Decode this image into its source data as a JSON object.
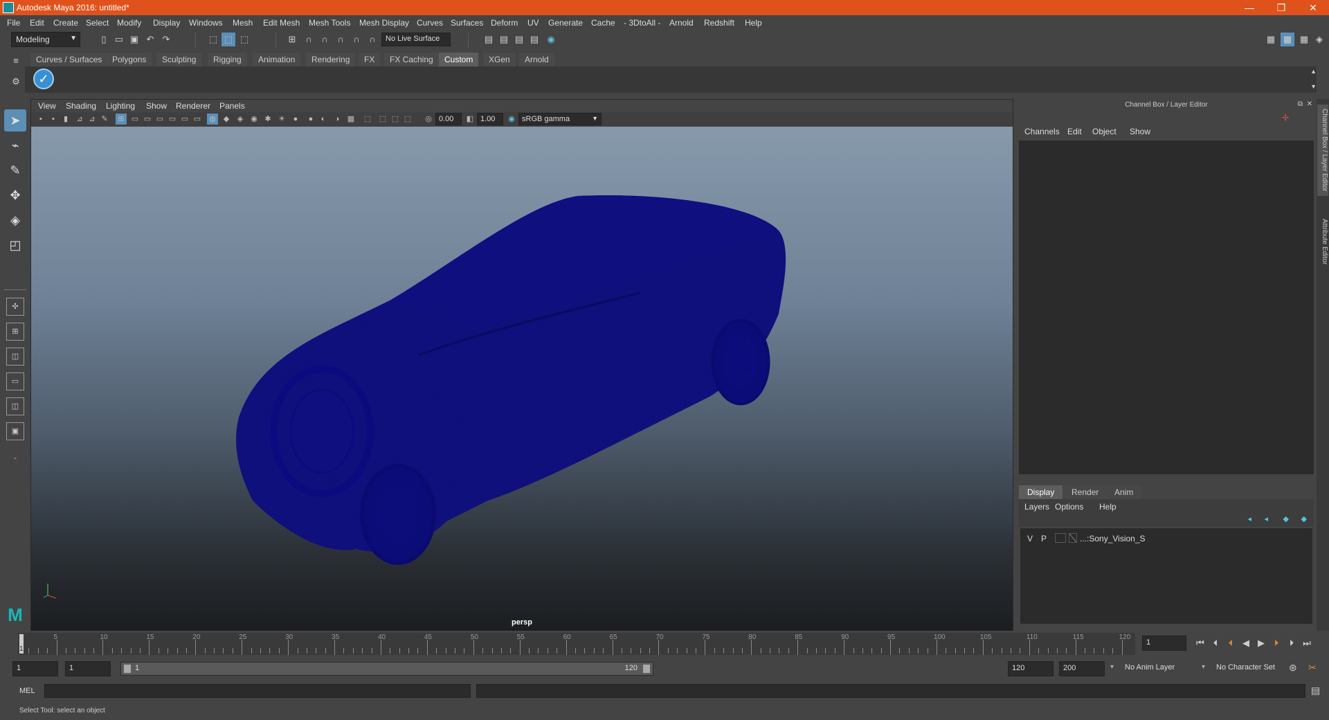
{
  "window": {
    "title": "Autodesk Maya 2016: untitled*",
    "minimize": "—",
    "maximize": "❐",
    "close": "✕"
  },
  "menubar": [
    "File",
    "Edit",
    "Create",
    "Select",
    "Modify",
    "Display",
    "Windows",
    "Mesh",
    "Edit Mesh",
    "Mesh Tools",
    "Mesh Display",
    "Curves",
    "Surfaces",
    "Deform",
    "UV",
    "Generate",
    "Cache",
    "- 3DtoAll -",
    "Arnold",
    "Redshift",
    "Help"
  ],
  "statusline": {
    "mode": "Modeling",
    "live_surface": "No Live Surface"
  },
  "shelf": {
    "tabs": [
      "Curves / Surfaces",
      "Polygons",
      "Sculpting",
      "Rigging",
      "Animation",
      "Rendering",
      "FX",
      "FX Caching",
      "Custom",
      "XGen",
      "Arnold"
    ],
    "active_tab": "Custom"
  },
  "viewport": {
    "menu": [
      "View",
      "Shading",
      "Lighting",
      "Show",
      "Renderer",
      "Panels"
    ],
    "exposure": "0.00",
    "gamma": "1.00",
    "color_space": "sRGB gamma",
    "camera": "persp",
    "wire_color": "#0a0a6e"
  },
  "channelbox": {
    "header": "Channel Box / Layer Editor",
    "menu": [
      "Channels",
      "Edit",
      "Object",
      "Show"
    ]
  },
  "layers": {
    "tabs": [
      "Display",
      "Render",
      "Anim"
    ],
    "active_tab": "Display",
    "menu": [
      "Layers",
      "Options",
      "Help"
    ],
    "row": {
      "v": "V",
      "p": "P",
      "name": "...:Sony_Vision_S"
    }
  },
  "sidetabs": [
    "Channel Box / Layer Editor",
    "Attribute Editor"
  ],
  "timeline": {
    "labels": [
      "5",
      "10",
      "15",
      "20",
      "25",
      "30",
      "35",
      "40",
      "45",
      "50",
      "55",
      "60",
      "65",
      "70",
      "75",
      "80",
      "85",
      "90",
      "95",
      "100",
      "105",
      "110",
      "115",
      "120"
    ],
    "start_marker": "1",
    "current_frame": "1"
  },
  "range": {
    "start": "1",
    "playback_start": "1",
    "slider_start": "1",
    "slider_end": "120",
    "playback_end": "120",
    "end": "200",
    "anim_layer": "No Anim Layer",
    "character_set": "No Character Set"
  },
  "command": {
    "label": "MEL"
  },
  "help": {
    "text": "Select Tool: select an object"
  }
}
